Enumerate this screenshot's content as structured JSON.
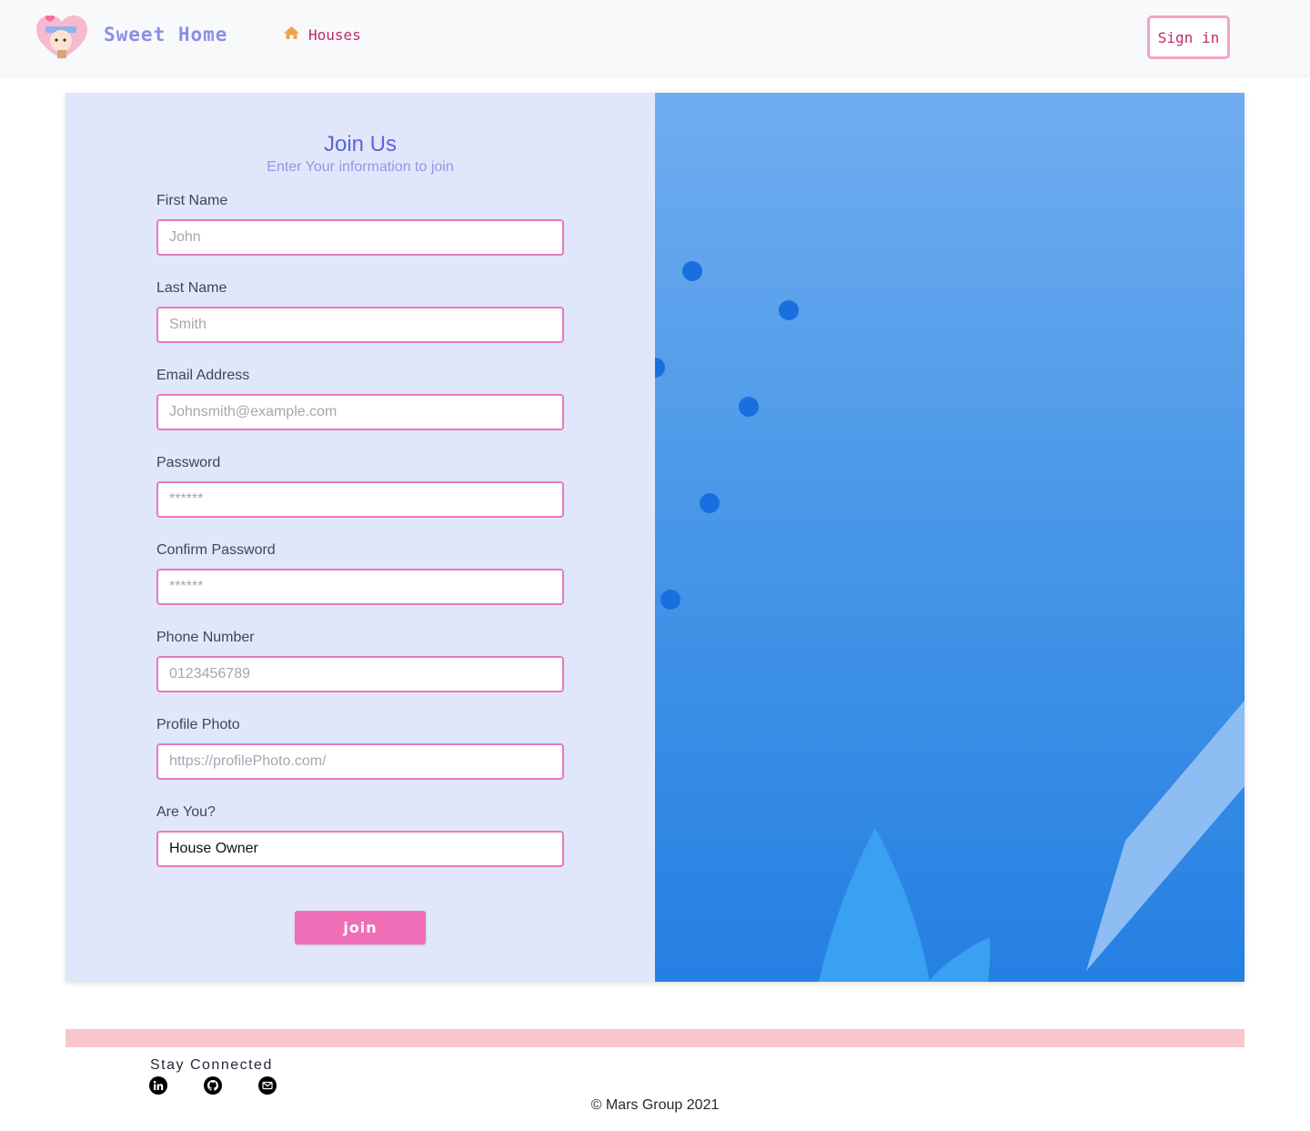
{
  "header": {
    "brand": "Sweet Home",
    "nav_houses": "Houses",
    "signin_label": "Sign in"
  },
  "form": {
    "title": "Join Us",
    "subtitle": "Enter Your information to join",
    "fields": [
      {
        "label": "First Name",
        "placeholder": "John",
        "value": ""
      },
      {
        "label": "Last Name",
        "placeholder": "Smith",
        "value": ""
      },
      {
        "label": "Email Address",
        "placeholder": "Johnsmith@example.com",
        "value": ""
      },
      {
        "label": "Password",
        "placeholder": "******",
        "value": ""
      },
      {
        "label": "Confirm Password",
        "placeholder": "******",
        "value": ""
      },
      {
        "label": "Phone Number",
        "placeholder": "0123456789",
        "value": ""
      },
      {
        "label": "Profile Photo",
        "placeholder": "https://profilePhoto.com/",
        "value": ""
      },
      {
        "label": "Are You?",
        "placeholder": "",
        "value": "House Owner"
      }
    ],
    "join_label": "join"
  },
  "footer": {
    "stay_connected": "Stay Connected",
    "social": [
      "linkedin-icon",
      "github-icon",
      "email-icon"
    ],
    "copyright": "© Mars Group 2021"
  },
  "colors": {
    "accent_pink": "#f06eb8",
    "brand_purple": "#8b8fe6",
    "title_indigo": "#5a67d8",
    "nav_magenta": "#be2a6a",
    "art_blue": "#2480e3"
  }
}
